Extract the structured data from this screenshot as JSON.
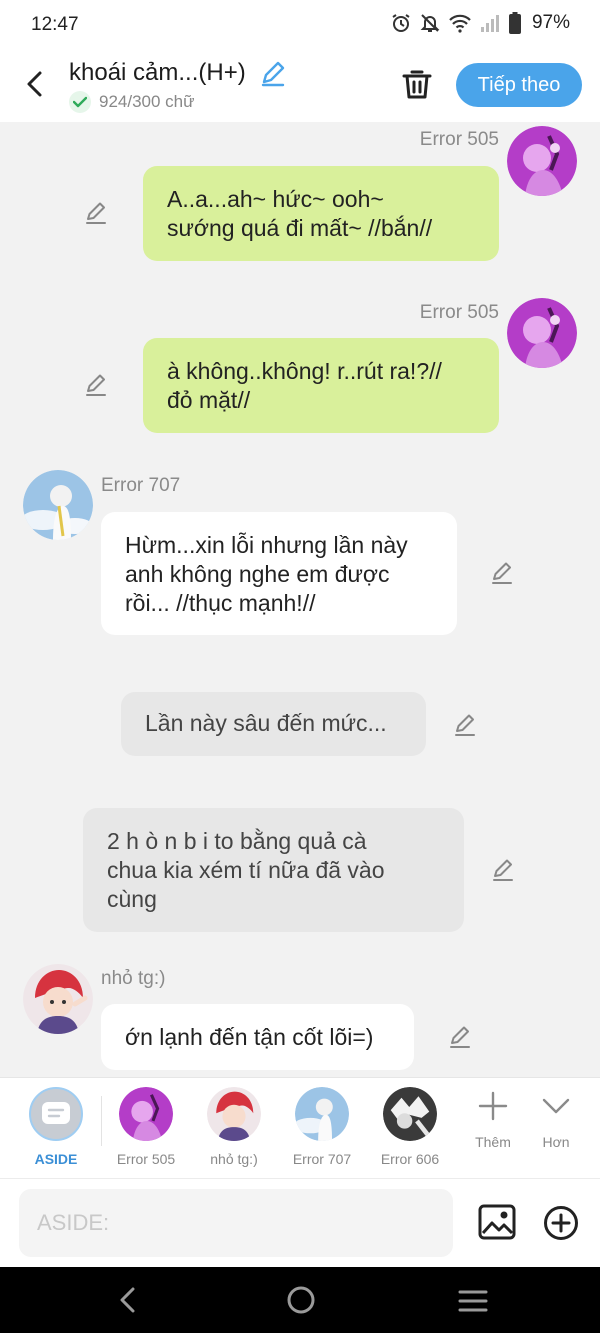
{
  "status": {
    "time": "12:47",
    "battery": "97%"
  },
  "header": {
    "title": "khoái cảm...(H+)",
    "word_count": "924/300 chữ",
    "next_label": "Tiếp theo"
  },
  "messages": [
    {
      "speaker": "Error 505",
      "side": "right",
      "text_lines": [
        "A..a...ah~ hức~ ooh~",
        "sướng quá đi mất~ //bắn//"
      ]
    },
    {
      "speaker": "Error 505",
      "side": "right",
      "text_lines": [
        "à không..không! r..rút ra!?//",
        "đỏ mặt//"
      ]
    },
    {
      "speaker": "Error 707",
      "side": "left",
      "text_lines": [
        "Hừm...xin lỗi nhưng lần này",
        "anh không nghe em được",
        "rồi... //thục mạnh!//"
      ]
    },
    {
      "speaker": "",
      "side": "aside",
      "text_lines": [
        "Lần này sâu đến mức..."
      ]
    },
    {
      "speaker": "",
      "side": "aside",
      "text_lines": [
        "2 h ò n b i to bằng quả cà",
        "chua kia xém tí nữa đã vào",
        "cùng"
      ]
    },
    {
      "speaker": "nhỏ tg:)",
      "side": "left",
      "text_lines": [
        "ớn lạnh đến tận cốt lõi=)"
      ]
    }
  ],
  "characters": [
    {
      "label": "ASIDE",
      "active": true
    },
    {
      "label": "Error 505"
    },
    {
      "label": "nhỏ tg:)"
    },
    {
      "label": "Error 707"
    },
    {
      "label": "Error 606"
    }
  ],
  "more_actions": {
    "add_label": "Thêm",
    "more_label": "Hơn"
  },
  "input": {
    "placeholder": "ASIDE:",
    "value": ""
  },
  "colors": {
    "accent": "#4aa4ea",
    "right_bubble": "#d9f09b",
    "aside_bubble": "#e7e7e7"
  }
}
